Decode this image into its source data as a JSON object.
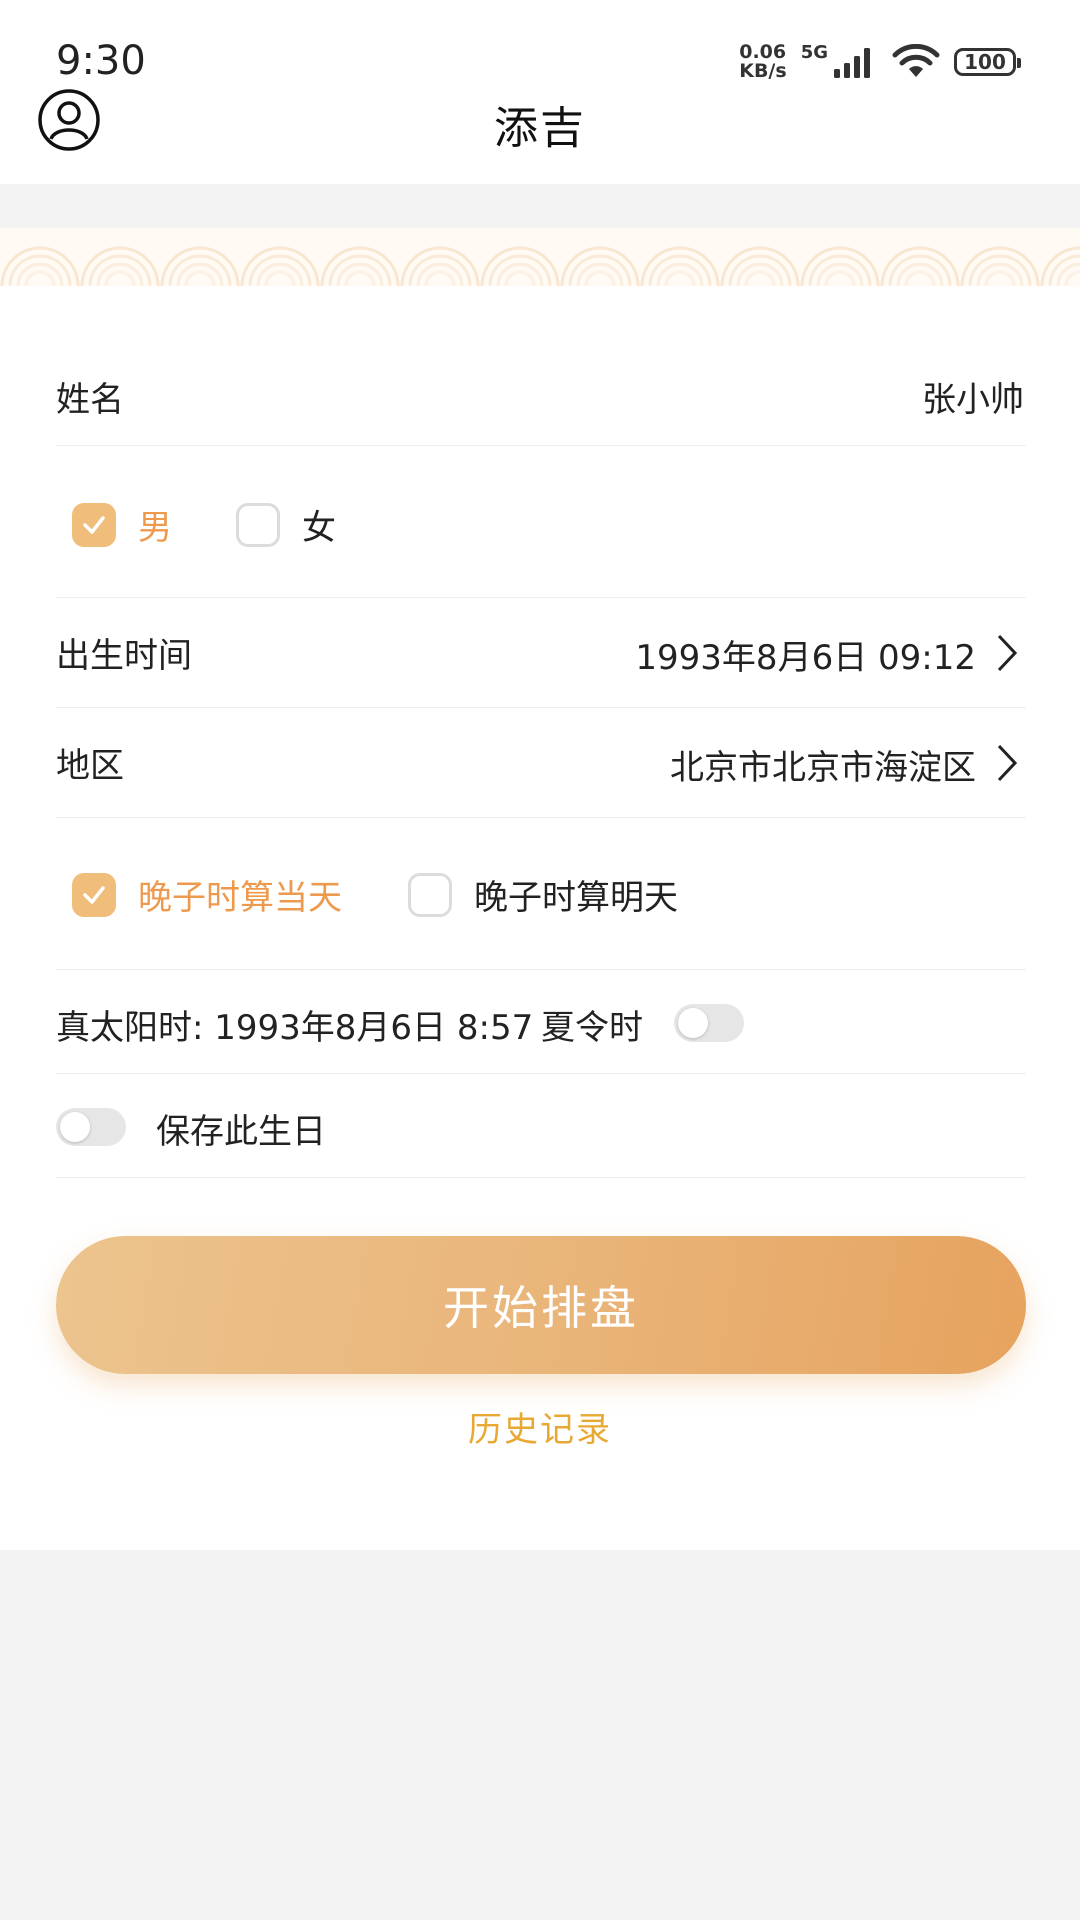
{
  "status_bar": {
    "time": "9:30",
    "net_speed_value": "0.06",
    "net_speed_unit": "KB/s",
    "network_type": "5G",
    "battery": "100"
  },
  "header": {
    "title": "添吉",
    "avatar_icon": "user-circle-icon"
  },
  "form": {
    "name_label": "姓名",
    "name_value": "张小帅",
    "gender": {
      "male_label": "男",
      "female_label": "女",
      "selected": "男"
    },
    "birth_time_label": "出生时间",
    "birth_time_value": "1993年8月6日 09:12",
    "region_label": "地区",
    "region_value": "北京市北京市海淀区",
    "late_zi": {
      "today_label": "晚子时算当天",
      "tomorrow_label": "晚子时算明天",
      "selected": "晚子时算当天"
    },
    "true_solar_time": "真太阳时: 1993年8月6日 8:57",
    "dst_label": "夏令时",
    "dst_on": false,
    "save_birthday_label": "保存此生日",
    "save_birthday_on": false
  },
  "actions": {
    "start_label": "开始排盘",
    "history_label": "历史记录"
  },
  "colors": {
    "accent": "#ee9a4e",
    "checkbox_on": "#f0bd7a",
    "button_gradient_start": "#ecc48e",
    "button_gradient_end": "#e6a35e",
    "history_link": "#e8a934"
  }
}
